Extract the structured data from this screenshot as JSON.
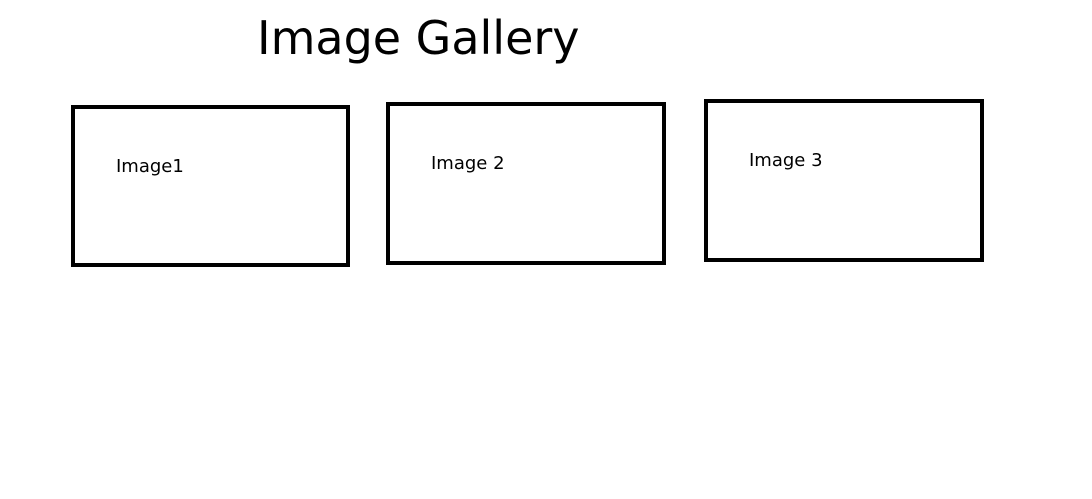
{
  "page": {
    "title": "Image Gallery"
  },
  "gallery": {
    "items": [
      {
        "label": "Image1"
      },
      {
        "label": "Image 2"
      },
      {
        "label": "Image 3"
      }
    ]
  }
}
